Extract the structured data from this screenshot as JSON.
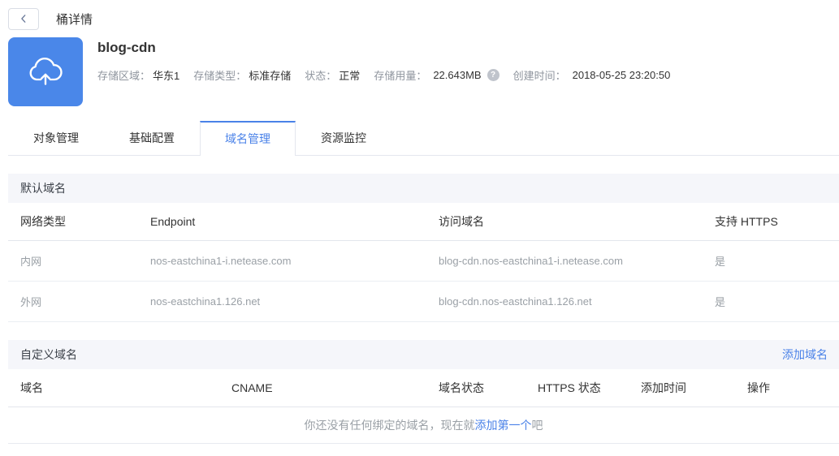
{
  "colors": {
    "accent": "#4a82e8",
    "icon_bg": "#4a87e9"
  },
  "topbar": {
    "title": "桶详情"
  },
  "bucket": {
    "name": "blog-cdn",
    "info": [
      {
        "label": "存储区域：",
        "value": "华东1"
      },
      {
        "label": "存储类型：",
        "value": "标准存储"
      },
      {
        "label": "状态：",
        "value": "正常"
      },
      {
        "label": "存储用量：",
        "value": "22.643MB"
      },
      {
        "label": "创建时间：",
        "value": "2018-05-25 23:20:50"
      }
    ],
    "help_icon": "?"
  },
  "tabs": [
    {
      "label": "对象管理",
      "active": false
    },
    {
      "label": "基础配置",
      "active": false
    },
    {
      "label": "域名管理",
      "active": true
    },
    {
      "label": "资源监控",
      "active": false
    }
  ],
  "default_domain": {
    "section_title": "默认域名",
    "columns": [
      "网络类型",
      "Endpoint",
      "访问域名",
      "支持 HTTPS"
    ],
    "rows": [
      {
        "network_type": "内网",
        "endpoint": "nos-eastchina1-i.netease.com",
        "access_domain": "blog-cdn.nos-eastchina1-i.netease.com",
        "https": "是"
      },
      {
        "network_type": "外网",
        "endpoint": "nos-eastchina1.126.net",
        "access_domain": "blog-cdn.nos-eastchina1.126.net",
        "https": "是"
      }
    ]
  },
  "custom_domain": {
    "section_title": "自定义域名",
    "add_button": "添加域名",
    "columns": [
      "域名",
      "CNAME",
      "域名状态",
      "HTTPS 状态",
      "添加时间",
      "操作"
    ],
    "empty": {
      "prefix": "你还没有任何绑定的域名，现在就",
      "link": "添加第一个",
      "suffix": "吧"
    }
  }
}
